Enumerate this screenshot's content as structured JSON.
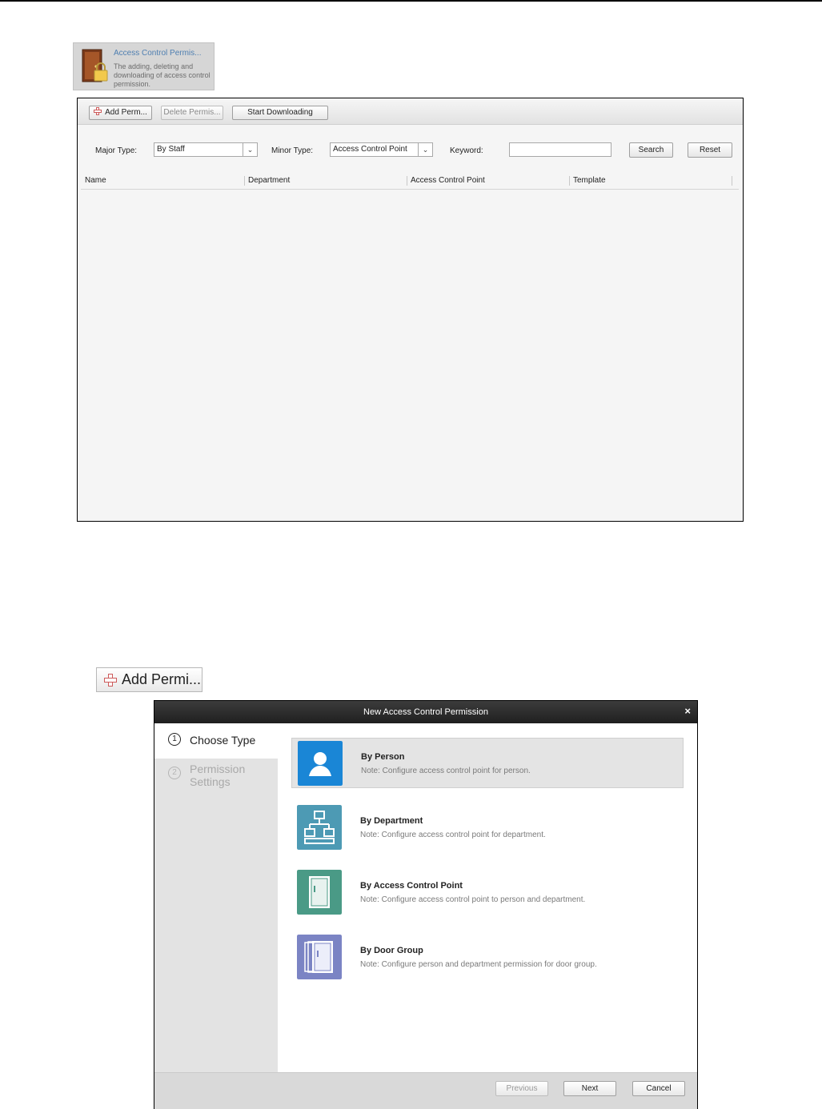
{
  "module_tile": {
    "title": "Access Control Permis...",
    "description": "The adding, deleting and downloading of access control permission."
  },
  "toolbar": {
    "add_label": "Add Perm...",
    "delete_label": "Delete Permis...",
    "download_label": "Start Downloading"
  },
  "filters": {
    "major_type_label": "Major Type:",
    "major_type_value": "By Staff",
    "minor_type_label": "Minor Type:",
    "minor_type_value": "Access Control Point",
    "keyword_label": "Keyword:",
    "keyword_value": "",
    "search_label": "Search",
    "reset_label": "Reset"
  },
  "table": {
    "columns": [
      "Name",
      "Department",
      "Access Control Point",
      "Template"
    ]
  },
  "add_button_large": {
    "label": "Add Permi..."
  },
  "dialog": {
    "title": "New Access Control Permission",
    "close_glyph": "×",
    "steps": [
      {
        "num": "1",
        "label": "Choose Type",
        "active": true
      },
      {
        "num": "2",
        "label": "Permission Settings",
        "active": false
      }
    ],
    "options": [
      {
        "title": "By Person",
        "note": "Note: Configure access control point for person.",
        "icon": "person-icon",
        "color": "#1a86d6",
        "selected": true
      },
      {
        "title": "By Department",
        "note": "Note: Configure access control point for department.",
        "icon": "department-icon",
        "color": "#4d9ab4",
        "selected": false
      },
      {
        "title": "By Access Control Point",
        "note": "Note: Configure access control point to person and department.",
        "icon": "door-icon",
        "color": "#4a9a86",
        "selected": false
      },
      {
        "title": "By Door Group",
        "note": "Note: Configure person and department permission for door group.",
        "icon": "door-group-icon",
        "color": "#7b84c4",
        "selected": false
      }
    ],
    "footer": {
      "previous_label": "Previous",
      "next_label": "Next",
      "cancel_label": "Cancel"
    }
  }
}
